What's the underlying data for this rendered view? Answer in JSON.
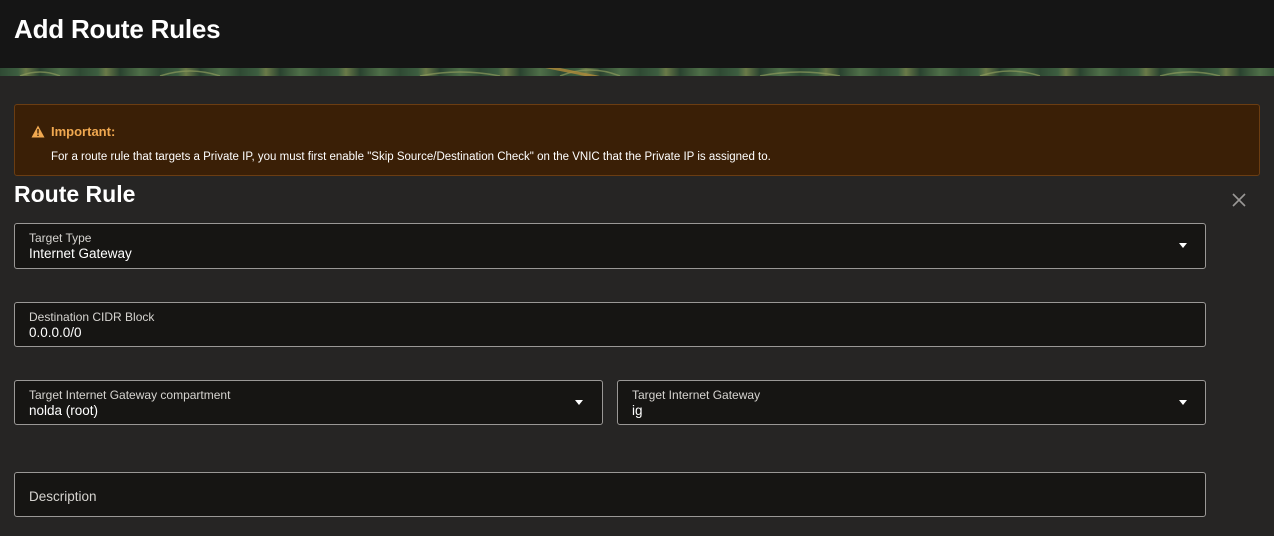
{
  "header": {
    "title": "Add Route Rules"
  },
  "alert": {
    "title": "Important:",
    "body": "For a route rule that targets a Private IP, you must first enable \"Skip Source/Destination Check\" on the VNIC that the Private IP is assigned to.",
    "icon": "warning-icon",
    "color": "#f0a850"
  },
  "route_rule": {
    "title": "Route Rule",
    "close_icon": "close-icon",
    "target_type": {
      "label": "Target Type",
      "value": "Internet Gateway"
    },
    "destination_cidr": {
      "label": "Destination CIDR Block",
      "value": "0.0.0.0/0"
    },
    "compartment": {
      "label": "Target Internet Gateway compartment",
      "value": "nolda (root)"
    },
    "gateway": {
      "label": "Target Internet Gateway",
      "value": "ig"
    },
    "description": {
      "placeholder": "Description"
    }
  }
}
